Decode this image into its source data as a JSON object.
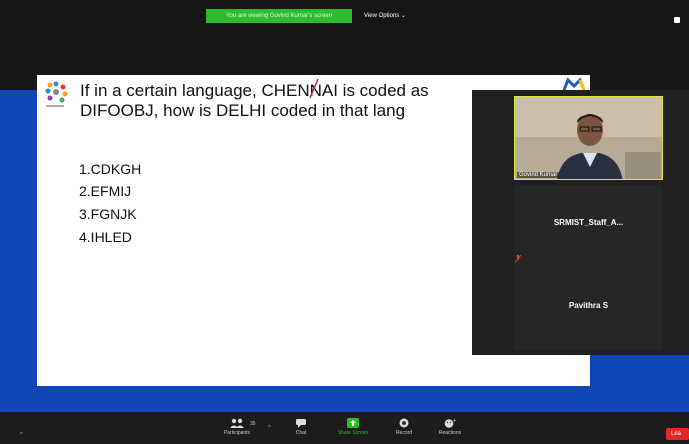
{
  "banner": {
    "text": "You are viewing Govind Kumar's screen"
  },
  "view_options": {
    "label": "View Options ⌄"
  },
  "slide": {
    "line1": "If in a certain language, CHENNAI is coded as",
    "line2": "DIFOOBJ, how is DELHI coded in that lang",
    "options": [
      "1.CDKGH",
      "2.EFMIJ",
      "3.FGNJK",
      "4.IHLED"
    ]
  },
  "participants_panel": {
    "video_name": "Govind Kumar",
    "tiles": [
      "SRMIST_Staff_A...",
      "Pavithra S"
    ]
  },
  "toolbar": {
    "participants_label": "Participants",
    "participants_count": "35",
    "chat_label": "Chat",
    "share_label": "Share Screen",
    "record_label": "Record",
    "reactions_label": "Reactions",
    "leave_label": "Lea"
  },
  "colors": {
    "accent_green": "#2bbd2f",
    "brand_blue": "#1046b8",
    "leave_red": "#e02828"
  }
}
